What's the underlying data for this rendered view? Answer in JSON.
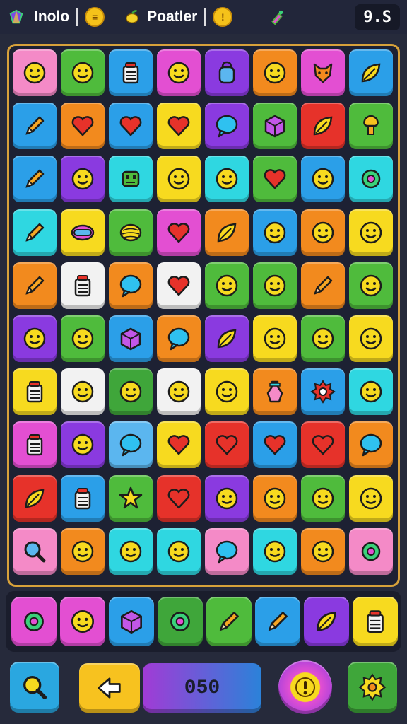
{
  "header": {
    "title": "Inolo",
    "label_2": "Poatler",
    "score": "9.S",
    "coin_glyph": "≡",
    "coin2_glyph": "!"
  },
  "colors": {
    "pink": "#f48ac7",
    "green": "#4fbb3c",
    "blue": "#2b9fe8",
    "purple": "#8a3ae0",
    "orange": "#f28a1e",
    "magenta": "#e34fd2",
    "yellow": "#f7da1f",
    "cyan": "#2fd7e1",
    "red": "#e6322a",
    "white": "#f2f2f2",
    "dgreen": "#3fa63a",
    "lblue": "#5bb6ef"
  },
  "board": {
    "columns": 8,
    "rows": 10,
    "tiles": [
      [
        "pink:face",
        "green:face",
        "blue:jar",
        "magenta:face",
        "purple:bag",
        "orange:face",
        "magenta:fox",
        "blue:leaf"
      ],
      [
        "blue:pencil",
        "orange:heart",
        "blue:heart",
        "yellow:heart",
        "purple:bubble",
        "green:box",
        "red:leaf",
        "green:tree"
      ],
      [
        "blue:pencil",
        "purple:face",
        "cyan:robot",
        "yellow:face",
        "cyan:face",
        "green:heart",
        "blue:face",
        "cyan:circle"
      ],
      [
        "cyan:pencil",
        "yellow:mask",
        "green:lemon",
        "magenta:heart",
        "orange:leaf",
        "blue:face",
        "orange:face",
        "yellow:face"
      ],
      [
        "orange:pencil",
        "white:jar",
        "orange:bubble",
        "white:heart",
        "green:face",
        "green:face",
        "orange:pencil",
        "green:face"
      ],
      [
        "purple:face",
        "green:face",
        "blue:box",
        "orange:bubble",
        "purple:leaf",
        "yellow:face",
        "green:face",
        "yellow:face"
      ],
      [
        "yellow:jar",
        "white:face",
        "dgreen:face",
        "white:face",
        "yellow:face",
        "orange:bottle",
        "blue:gear",
        "cyan:face"
      ],
      [
        "magenta:jar",
        "purple:face",
        "lblue:bubble",
        "yellow:heart",
        "red:heart",
        "blue:heart",
        "red:heart",
        "orange:bubble"
      ],
      [
        "red:leaf",
        "blue:jar",
        "green:star",
        "red:heart",
        "purple:face",
        "orange:face",
        "green:face",
        "yellow:face"
      ],
      [
        "pink:magnifier",
        "orange:face",
        "cyan:face",
        "cyan:face",
        "pink:bubble",
        "cyan:face",
        "orange:face",
        "pink:circle"
      ]
    ]
  },
  "tray": {
    "slots": [
      "magenta:circle",
      "magenta:face",
      "blue:box",
      "dgreen:circle",
      "green:pencil",
      "blue:pencil",
      "purple:leaf",
      "yellow:jar"
    ]
  },
  "footer": {
    "score_value": "050",
    "left_button_icon": "magnifier-icon",
    "back_button_icon": "arrow-left-icon",
    "hint_button_icon": "exclamation-icon",
    "settings_button_icon": "gear-icon"
  }
}
